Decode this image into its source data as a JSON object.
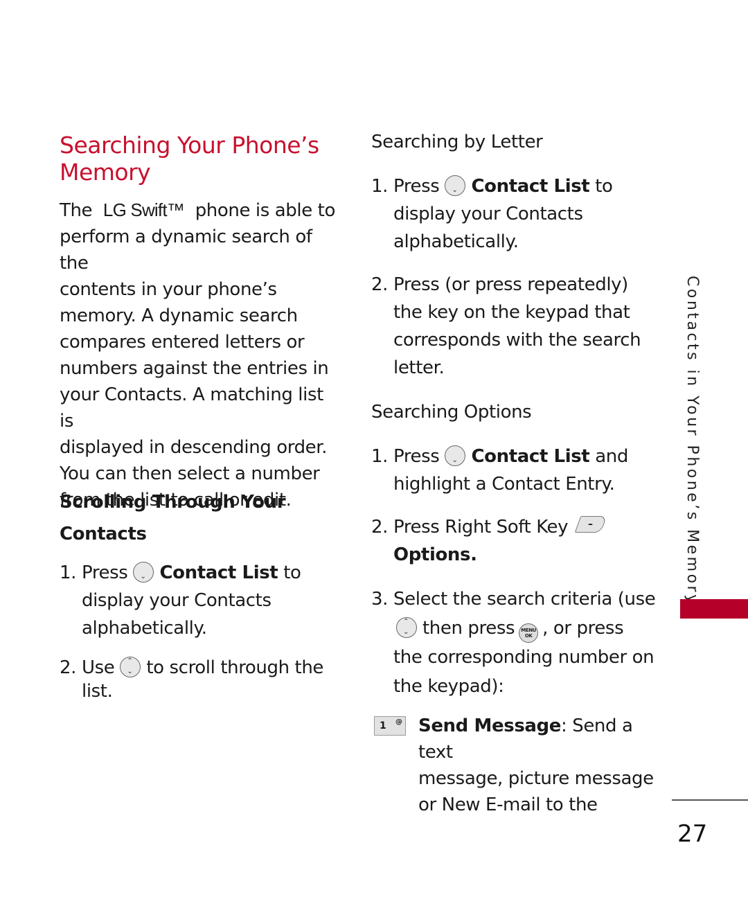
{
  "page": {
    "title": "Searching Your Phone’s Memory",
    "intro_prefix": "The",
    "product_name": "LG Swift™",
    "intro_lines": [
      "phone is able to",
      "perform a dynamic search of the",
      "contents in your phone’s",
      "memory. A dynamic search",
      "compares entered letters or",
      "numbers against the entries in",
      "your Contacts. A matching list is",
      "displayed in descending order.",
      "You can then select a number",
      "from the list to call or edit."
    ],
    "sections": {
      "scrolling": {
        "heading_line1": "Scrolling Through Your",
        "heading_line2": "Contacts",
        "step1": {
          "num": "1.",
          "pre": "Press",
          "bold": "Contact List",
          "post": "to",
          "line2": "display your Contacts",
          "line3": "alphabetically."
        },
        "step2": {
          "num": "2.",
          "pre": "Use",
          "post": "to scroll through the",
          "line2": "list."
        }
      },
      "by_letter": {
        "heading": "Searching by Letter",
        "step1": {
          "num": "1.",
          "pre": "Press",
          "bold": "Contact List",
          "post": "to",
          "line2": "display your Contacts",
          "line3": "alphabetically."
        },
        "step2": {
          "num": "2.",
          "lines": [
            "Press (or press repeatedly)",
            "the key on the keypad that",
            "corresponds with the search",
            "letter."
          ]
        }
      },
      "options": {
        "heading": "Searching Options",
        "step1": {
          "num": "1.",
          "pre": "Press",
          "bold": "Contact List",
          "post": "and",
          "line2": "highlight a Contact Entry."
        },
        "step2": {
          "num": "2.",
          "pre": "Press Right Soft Key",
          "softkey_glyph": "–",
          "line2": "Options."
        },
        "step3": {
          "num": "3.",
          "line1": "Select the search criteria (use",
          "mid1": "then press",
          "mid2": ", or press",
          "line3": "the corresponding number on",
          "line4": "the keypad):",
          "menu_key_top": "MENU",
          "menu_key_bottom": "OK"
        },
        "option1": {
          "key_label": "1",
          "key_glyph": "@",
          "bold": "Send Message",
          "rest": ": Send a text",
          "line2": "message, picture message",
          "line3": "or New E-mail to the"
        }
      }
    },
    "side_label": "Contacts in Your Phone’s Memory",
    "page_number": "27",
    "colors": {
      "accent": "#c8102e",
      "tab": "#b5002a"
    }
  }
}
